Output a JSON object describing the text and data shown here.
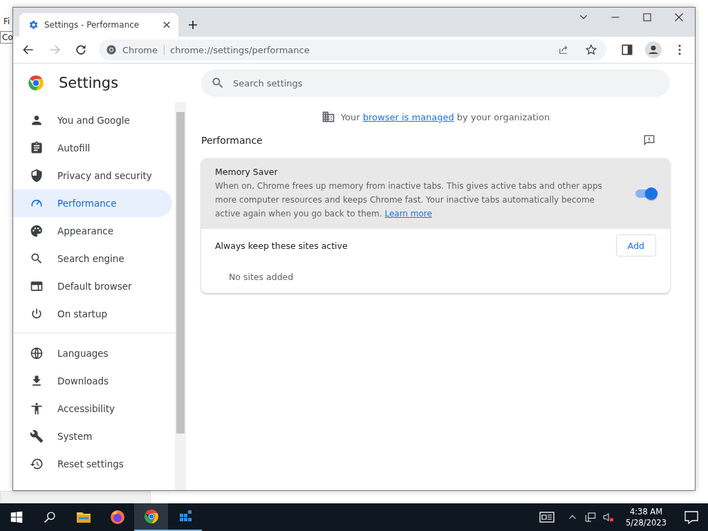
{
  "background_window": {
    "menu": "Fi",
    "field": "Co"
  },
  "window": {
    "tab": {
      "title": "Settings - Performance",
      "selected": true
    }
  },
  "toolbar": {
    "site_label": "Chrome",
    "url": "chrome://settings/performance"
  },
  "sidebar": {
    "title": "Settings",
    "groups": [
      [
        {
          "label": "You and Google",
          "selected": false
        },
        {
          "label": "Autofill",
          "selected": false
        },
        {
          "label": "Privacy and security",
          "selected": false
        },
        {
          "label": "Performance",
          "selected": true
        },
        {
          "label": "Appearance",
          "selected": false
        },
        {
          "label": "Search engine",
          "selected": false
        },
        {
          "label": "Default browser",
          "selected": false
        },
        {
          "label": "On startup",
          "selected": false
        }
      ],
      [
        {
          "label": "Languages",
          "selected": false
        },
        {
          "label": "Downloads",
          "selected": false
        },
        {
          "label": "Accessibility",
          "selected": false
        },
        {
          "label": "System",
          "selected": false
        },
        {
          "label": "Reset settings",
          "selected": false
        }
      ]
    ]
  },
  "search": {
    "placeholder": "Search settings"
  },
  "managed_notice": {
    "before": "Your",
    "link": "browser is managed",
    "after": "by your organization"
  },
  "section_title": "Performance",
  "memory_saver": {
    "title": "Memory Saver",
    "description": "When on, Chrome frees up memory from inactive tabs. This gives active tabs and other apps more computer resources and keeps Chrome fast. Your inactive tabs automatically become active again when you go back to them.",
    "link": "Learn more",
    "on": true
  },
  "sites": {
    "label": "Always keep these sites active",
    "button": "Add",
    "empty": "No sites added"
  },
  "taskbar": {
    "apps": [
      {
        "selected": false,
        "running": false
      },
      {
        "selected": false,
        "running": false
      },
      {
        "selected": true,
        "running": true
      },
      {
        "selected": false,
        "running": true
      }
    ],
    "time": "4:38 AM",
    "date": "5/28/2023"
  }
}
